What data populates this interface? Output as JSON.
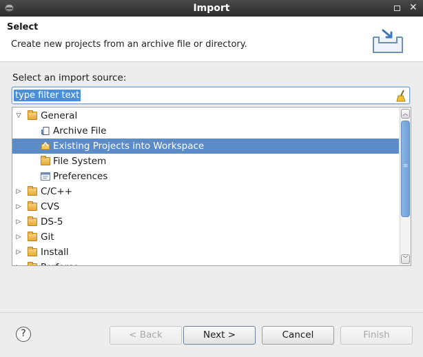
{
  "window": {
    "title": "Import",
    "maximize_glyph": "□",
    "close_glyph": "✕"
  },
  "header": {
    "title": "Select",
    "description": "Create new projects from an archive file or directory.",
    "icon": "import-wizard-icon"
  },
  "source_label": "Select an import source:",
  "filter": {
    "placeholder": "type filter text",
    "clear_icon": "broom-clear-icon"
  },
  "tree": {
    "items": [
      {
        "label": "General",
        "expanded": true,
        "level": 0,
        "icon": "folder-open-icon"
      },
      {
        "label": "Archive File",
        "level": 1,
        "icon": "archive-file-icon"
      },
      {
        "label": "Existing Projects into Workspace",
        "level": 1,
        "icon": "existing-projects-icon",
        "selected": true
      },
      {
        "label": "File System",
        "level": 1,
        "icon": "folder-icon"
      },
      {
        "label": "Preferences",
        "level": 1,
        "icon": "preferences-icon"
      },
      {
        "label": "C/C++",
        "expanded": false,
        "level": 0,
        "icon": "folder-icon"
      },
      {
        "label": "CVS",
        "expanded": false,
        "level": 0,
        "icon": "folder-icon"
      },
      {
        "label": "DS-5",
        "expanded": false,
        "level": 0,
        "icon": "folder-icon"
      },
      {
        "label": "Git",
        "expanded": false,
        "level": 0,
        "icon": "folder-icon"
      },
      {
        "label": "Install",
        "expanded": false,
        "level": 0,
        "icon": "folder-icon"
      },
      {
        "label": "Perforce",
        "expanded": false,
        "level": 0,
        "icon": "folder-icon"
      }
    ]
  },
  "buttons": {
    "help": "?",
    "back": "< Back",
    "next": "Next >",
    "cancel": "Cancel",
    "finish": "Finish"
  },
  "colors": {
    "selection": "#5b8cc7",
    "titlebar": "#2c2c2c",
    "filter_highlight": "#4a90d9"
  }
}
